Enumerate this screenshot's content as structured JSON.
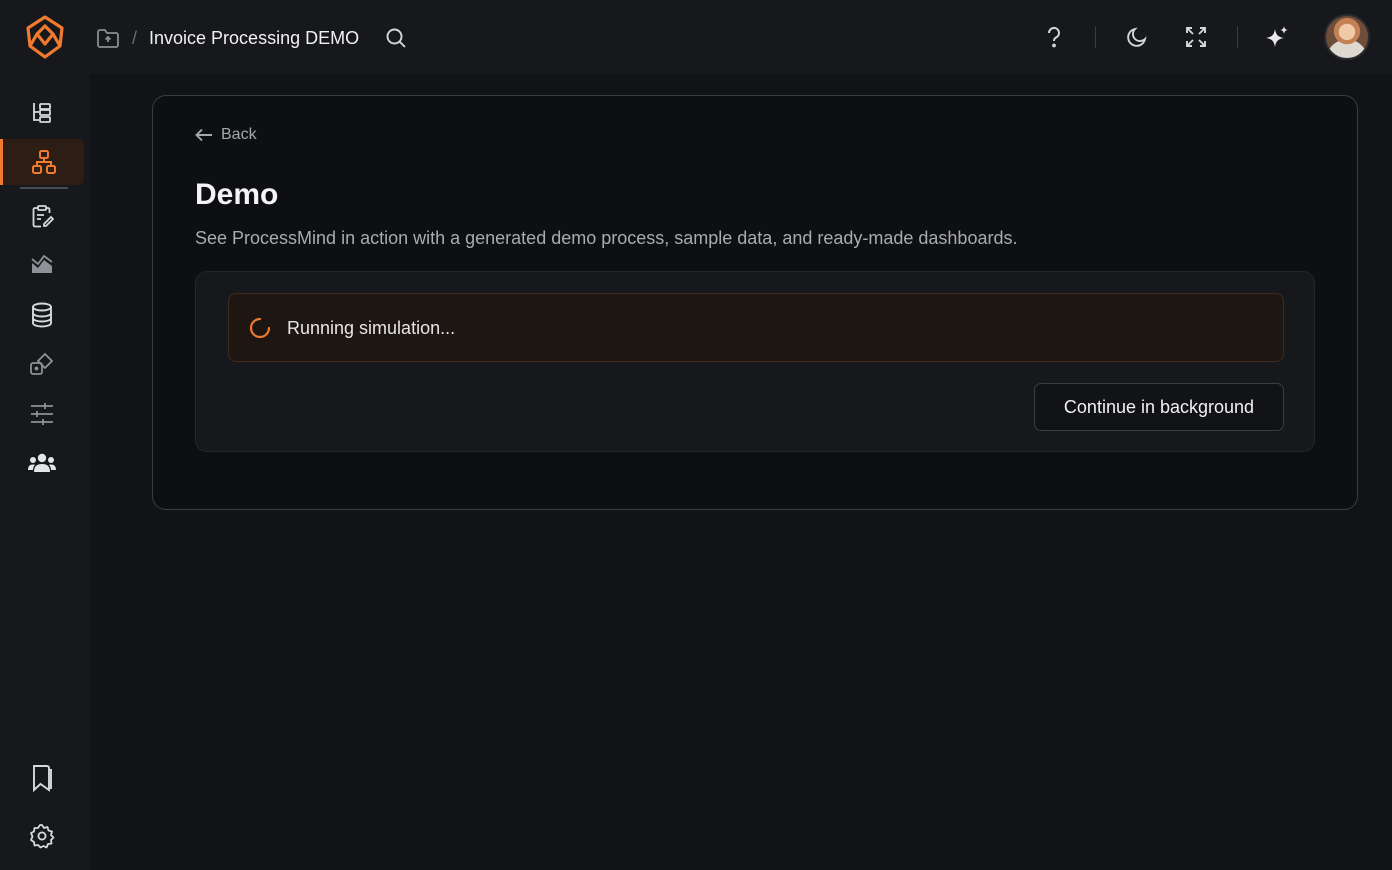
{
  "header": {
    "breadcrumb_separator": "/",
    "project_title": "Invoice Processing DEMO",
    "accent_color": "#f07a2e"
  },
  "header_icons": [
    "folder-icon",
    "search-icon",
    "help-icon",
    "moon-icon",
    "expand-icon",
    "sparkles-icon"
  ],
  "sidebar": {
    "items": [
      {
        "icon": "process-tree-icon",
        "active": false
      },
      {
        "icon": "hierarchy-icon",
        "active": true
      },
      {
        "icon": "clipboard-edit-icon",
        "active": false
      },
      {
        "icon": "chart-area-icon",
        "active": false
      },
      {
        "icon": "database-icon",
        "active": false
      },
      {
        "icon": "shapes-icon",
        "active": false
      },
      {
        "icon": "sliders-icon",
        "active": false
      },
      {
        "icon": "users-icon",
        "active": false
      }
    ],
    "bottom_items": [
      {
        "icon": "bookmark-icon"
      },
      {
        "icon": "settings-icon"
      }
    ]
  },
  "main": {
    "back_label": "Back",
    "title": "Demo",
    "description": "See ProcessMind in action with a generated demo process, sample data, and ready-made dashboards.",
    "status_text": "Running simulation...",
    "background_button": "Continue in background"
  }
}
